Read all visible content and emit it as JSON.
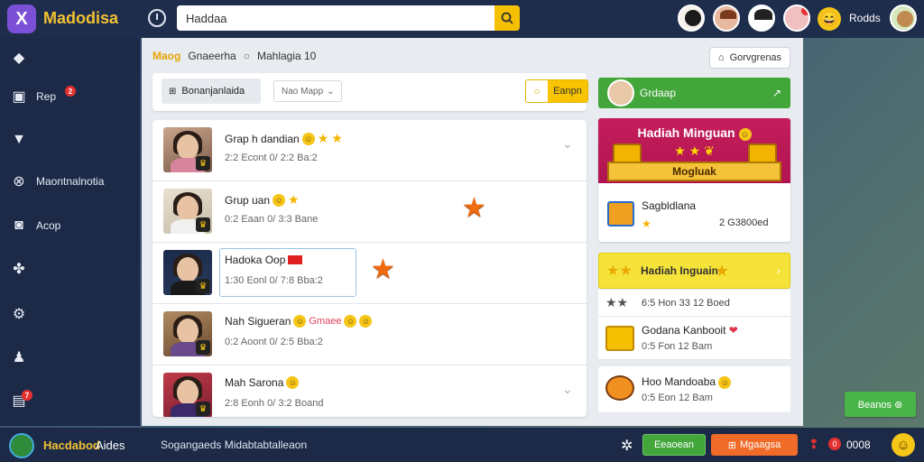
{
  "app": {
    "title": "Madodisa",
    "logo": "X"
  },
  "search": {
    "value": "Haddaa"
  },
  "topbar": {
    "user_label": "Rodds",
    "emoji": "😄"
  },
  "sidebar": {
    "items": [
      {
        "label": "",
        "icon": "diamond-icon"
      },
      {
        "label": "Rep",
        "icon": "window-icon",
        "badge": "2"
      },
      {
        "label": "",
        "icon": "wifi-icon"
      },
      {
        "label": "Maontnalnotia",
        "icon": "close-circle-icon"
      },
      {
        "label": "Acop",
        "icon": "camera-icon"
      },
      {
        "label": "",
        "icon": "bike-icon"
      },
      {
        "label": "",
        "icon": "gear-icon"
      },
      {
        "label": "",
        "icon": "user-icon"
      },
      {
        "label": "",
        "icon": "chat-icon",
        "badge": "7"
      }
    ]
  },
  "breadcrumb": {
    "first": "Maog",
    "second": "Gnaeerha",
    "third": "Mahlagia 10"
  },
  "top_button": {
    "label": "Gorvgrenas"
  },
  "toolbar": {
    "filter_label": "Bonanjanlaida",
    "select_value": "Nao Mapp",
    "action_label": "Eanpn"
  },
  "rows": [
    {
      "name": "Grap h dandian",
      "meta": "2:2 Econt 0/ 2:2 Ba:2"
    },
    {
      "name": "Grup uan",
      "meta": "0:2 Eaan 0/ 3:3 Bane"
    },
    {
      "name": "Hadoka Oop",
      "meta": "1:30 Eonl 0/ 7:8 Bba:2"
    },
    {
      "name": "Nah Sigueran",
      "meta": "0:2 Aoont 0/ 2:5 Bba:2"
    },
    {
      "name": "Mah Sarona",
      "meta": "2:8 Eonh 0/ 3:2 Boand"
    }
  ],
  "right": {
    "group_label": "Grdaap",
    "reward_title": "Hadiah Minguan",
    "reward_ribbon": "Mogluak",
    "reward_item_title": "Sagbldlana",
    "reward_item_amount": "2 G3800ed",
    "weekly_title": "Hadiah Inguain",
    "weekly_rows": [
      {
        "text": "6:5 Hon 33 12 Boed"
      },
      {
        "title": "Godana Kanbooit",
        "sub": "0:5 Fon 12 Bam"
      },
      {
        "title": "Hoo Mandoaba",
        "sub": "0:5 Eon 12 Bam"
      }
    ]
  },
  "float_button": {
    "label": "Beanos ⊛"
  },
  "bottombar": {
    "name": "Hacdabod",
    "role": "Aides",
    "status": "Sogangaeds Midabtabtalleaon",
    "btn_green": "Eeaoean",
    "btn_orange": "Mgaagsa",
    "count": "0008",
    "dot": "0"
  }
}
